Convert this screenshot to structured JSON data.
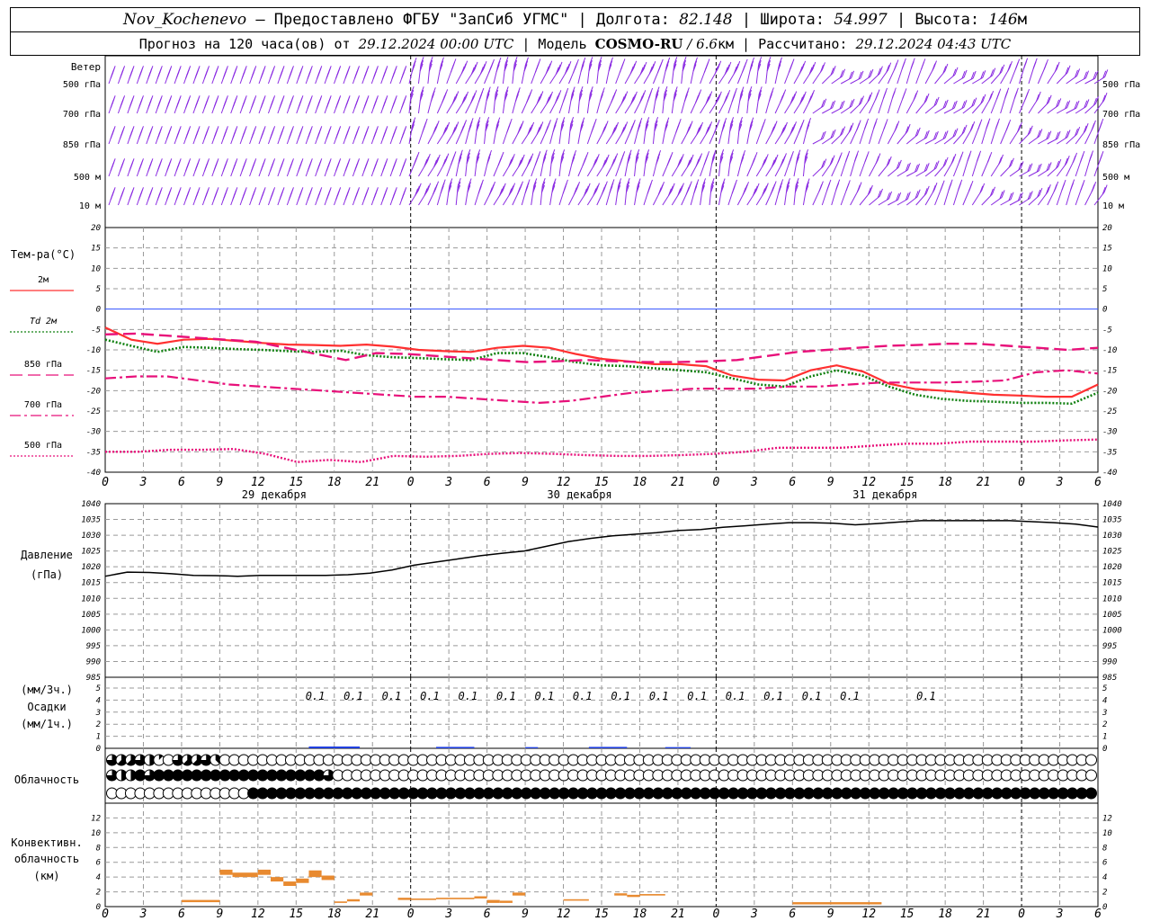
{
  "header": {
    "station": "Nov_Kochenevo",
    "provided_by": "— Предоставлено ФГБУ \"ЗапСиб УГМС\"",
    "sep1": " | Долгота: ",
    "lon": "82.148",
    "sep2": " | Широта: ",
    "lat": "54.997",
    "sep3": " | Высота: ",
    "alt": "146",
    "alt_unit": "м",
    "forecast_text": "Прогноз на 120 часа(ов) от ",
    "forecast_time": "29.12.2024 00:00 UTC",
    "model_text": " | Модель ",
    "model": "COSMO-RU",
    "model_sep": " / ",
    "resolution": "6.6",
    "resolution_unit": "км",
    "calc_text": " | Рассчитано: ",
    "calc_time": "29.12.2024 04:43 UTC"
  },
  "colors": {
    "t2m": "#ff3030",
    "td2m": "#108010",
    "t850": "#e8107a",
    "t700": "#e8107a",
    "t500": "#e8107a",
    "wind": "#8a2be2",
    "pressure": "#000000",
    "precip": "#2040e0",
    "convective": "#e88a30",
    "zero_line": "#3050ff"
  },
  "chart_data": [
    {
      "type": "barbs",
      "panel": "wind",
      "title": "Ветер",
      "levels": [
        "500 гПа",
        "700 гПа",
        "850 гПа",
        "500 м",
        "10  м"
      ],
      "x_hours": [
        0,
        3,
        6,
        9,
        12,
        15,
        18,
        21,
        24,
        27,
        30,
        33,
        36,
        39,
        42,
        45,
        48,
        51,
        54,
        57,
        60,
        63,
        66,
        69,
        72,
        75,
        78
      ],
      "barb_count_per_level": 106
    },
    {
      "type": "line",
      "panel": "temperature",
      "ylabel": "Тем-ра(°С)",
      "ylim": [
        -40,
        20
      ],
      "yticks": [
        20,
        15,
        10,
        5,
        0,
        -5,
        -10,
        -15,
        -20,
        -25,
        -30,
        -35,
        -40
      ],
      "x_hours": [
        0,
        1,
        2,
        3,
        4,
        5,
        6,
        7,
        8,
        9,
        10,
        11,
        12,
        13,
        14,
        15,
        16,
        17,
        18,
        19,
        20,
        21,
        22,
        23,
        24,
        25,
        26,
        27
      ],
      "series": [
        {
          "name": "2м",
          "values": [
            -4.5,
            -7.5,
            -8.5,
            -7.5,
            -7.3,
            -7.8,
            -8.3,
            -8.7,
            -8.8,
            -9.0,
            -8.7,
            -9.2,
            -10.0,
            -10.3,
            -10.5,
            -9.5,
            -9.0,
            -9.5,
            -11.0,
            -12.2,
            -12.8,
            -13.5,
            -13.5,
            -14.0,
            -16.3,
            -17.3,
            -17.5,
            -15.0,
            -13.8,
            -15.3,
            -18.3,
            -19.6,
            -20.0,
            -20.5,
            -21.0,
            -21.2,
            -21.5,
            -21.5,
            -18.5
          ]
        },
        {
          "name": "Td 2м",
          "values": [
            -7.5,
            -9.0,
            -10.5,
            -9.3,
            -9.5,
            -9.8,
            -10.0,
            -10.3,
            -10.5,
            -10.2,
            -11.3,
            -11.8,
            -12.0,
            -12.3,
            -12.5,
            -10.8,
            -10.8,
            -11.8,
            -13.0,
            -13.8,
            -14.0,
            -14.5,
            -15.0,
            -15.5,
            -17.0,
            -18.5,
            -19.0,
            -16.5,
            -15.0,
            -16.3,
            -19.0,
            -21.0,
            -22.0,
            -22.5,
            -22.7,
            -23.0,
            -23.0,
            -23.2,
            -20.5
          ]
        },
        {
          "name": "850 гПа",
          "values": [
            -6.2,
            -6.0,
            -6.5,
            -7.0,
            -7.5,
            -8.0,
            -9.5,
            -11.0,
            -12.5,
            -10.8,
            -11.0,
            -11.5,
            -12.0,
            -12.5,
            -13.0,
            -12.8,
            -12.5,
            -12.8,
            -13.0,
            -13.0,
            -12.8,
            -12.5,
            -11.5,
            -10.5,
            -10.0,
            -9.5,
            -9.0,
            -8.8,
            -8.5,
            -8.5,
            -9.0,
            -9.5,
            -10.0,
            -9.5
          ]
        },
        {
          "name": "700 гПа",
          "values": [
            -17.0,
            -16.5,
            -16.5,
            -17.5,
            -18.5,
            -19.0,
            -19.5,
            -20.0,
            -20.5,
            -21.0,
            -21.5,
            -21.5,
            -22.0,
            -22.5,
            -23.0,
            -22.5,
            -21.5,
            -20.5,
            -20.0,
            -19.5,
            -19.5,
            -19.5,
            -19.0,
            -19.0,
            -18.5,
            -18.0,
            -18.0,
            -18.0,
            -17.8,
            -17.5,
            -15.5,
            -15.0,
            -15.8
          ]
        },
        {
          "name": "500 гПа",
          "values": [
            -35.0,
            -35.0,
            -34.5,
            -34.5,
            -34.3,
            -35.5,
            -37.5,
            -37.0,
            -37.5,
            -36.0,
            -36.2,
            -36.0,
            -35.5,
            -35.3,
            -35.5,
            -35.8,
            -36.0,
            -36.0,
            -35.8,
            -35.5,
            -35.0,
            -34.0,
            -34.0,
            -34.0,
            -33.5,
            -33.0,
            -33.0,
            -32.5,
            -32.5,
            -32.5,
            -32.2,
            -32.0
          ]
        }
      ],
      "x_tick_labels": [
        "0",
        "3",
        "6",
        "9",
        "12",
        "15",
        "18",
        "21",
        "0",
        "3",
        "6",
        "9",
        "12",
        "15",
        "18",
        "21",
        "0",
        "3",
        "6",
        "9",
        "12",
        "15",
        "18",
        "21",
        "0",
        "3",
        "6"
      ],
      "day_labels": [
        "29 декабря",
        "30 декабря",
        "31 декабря"
      ]
    },
    {
      "type": "line",
      "panel": "pressure",
      "ylabel": "Давление",
      "yunit": "(гПа)",
      "ylim": [
        985,
        1040
      ],
      "yticks": [
        1040,
        1035,
        1030,
        1025,
        1020,
        1015,
        1010,
        1005,
        1000,
        995,
        990,
        985
      ],
      "series": [
        {
          "name": "pressure",
          "values": [
            1017.0,
            1018.3,
            1018.2,
            1017.8,
            1017.3,
            1017.2,
            1017.0,
            1017.3,
            1017.3,
            1017.3,
            1017.3,
            1017.5,
            1018.0,
            1019.0,
            1020.5,
            1021.5,
            1022.5,
            1023.5,
            1024.3,
            1025.0,
            1026.5,
            1028.0,
            1029.0,
            1029.8,
            1030.3,
            1030.8,
            1031.5,
            1031.8,
            1032.5,
            1033.0,
            1033.5,
            1034.0,
            1034.0,
            1033.8,
            1033.3,
            1033.7,
            1034.2,
            1034.6,
            1034.6,
            1034.6,
            1034.6,
            1034.6,
            1034.3,
            1034.0,
            1033.5,
            1032.6
          ]
        }
      ]
    },
    {
      "type": "bar",
      "panel": "precipitation",
      "ylabel1": "(мм/3ч.)",
      "ylabel2": "Осадки",
      "ylabel3": "(мм/1ч.)",
      "ylim": [
        0,
        5
      ],
      "yticks": [
        5,
        4,
        3,
        2,
        1,
        0
      ],
      "labels_3h": [
        {
          "hour": 18,
          "text": "0.1"
        },
        {
          "hour": 21,
          "text": "0.1"
        },
        {
          "hour": 24,
          "text": "0.1"
        },
        {
          "hour": 27,
          "text": "0.1"
        },
        {
          "hour": 30,
          "text": "0.1"
        },
        {
          "hour": 33,
          "text": "0.1"
        },
        {
          "hour": 36,
          "text": "0.1"
        },
        {
          "hour": 39,
          "text": "0.1"
        },
        {
          "hour": 42,
          "text": "0.1"
        },
        {
          "hour": 45,
          "text": "0.1"
        },
        {
          "hour": 48,
          "text": "0.1"
        },
        {
          "hour": 51,
          "text": "0.1"
        },
        {
          "hour": 54,
          "text": "0.1"
        },
        {
          "hour": 57,
          "text": "0.1"
        },
        {
          "hour": 60,
          "text": "0.1"
        },
        {
          "hour": 66,
          "text": "0.1"
        }
      ],
      "hourly": [
        {
          "from": 16,
          "to": 20,
          "value": 0.15
        },
        {
          "from": 26,
          "to": 29,
          "value": 0.12
        },
        {
          "from": 33,
          "to": 34,
          "value": 0.1
        },
        {
          "from": 38,
          "to": 41,
          "value": 0.12
        },
        {
          "from": 44,
          "to": 46,
          "value": 0.1
        }
      ]
    },
    {
      "type": "symbols",
      "panel": "cloudiness",
      "ylabel": "Облачность",
      "rows": [
        {
          "name": "high",
          "octas": [
            6,
            5,
            5,
            6,
            4,
            1,
            0,
            6,
            5,
            5,
            6,
            3,
            0,
            0,
            0,
            0,
            0,
            0,
            0,
            0,
            0,
            0,
            0,
            0,
            0,
            0,
            0,
            0,
            0,
            0,
            0,
            0,
            0,
            0,
            0,
            0,
            0,
            0,
            0,
            0,
            0,
            0,
            0,
            0,
            0,
            0,
            0,
            0,
            0,
            0,
            0,
            0,
            0,
            0,
            0,
            0,
            0,
            0,
            0,
            0,
            0,
            0,
            0,
            0,
            0,
            0,
            0,
            0,
            0,
            0,
            0,
            0,
            0,
            0,
            0,
            0,
            0,
            0,
            0,
            0,
            0,
            0,
            0,
            0,
            0,
            0,
            0,
            0,
            0,
            0,
            0,
            0,
            0,
            0,
            0,
            0,
            0,
            0,
            0,
            0,
            0,
            0,
            0,
            0,
            0
          ]
        },
        {
          "name": "middle",
          "octas": [
            6,
            4,
            4,
            8,
            6,
            8,
            8,
            8,
            8,
            8,
            8,
            8,
            8,
            8,
            8,
            8,
            8,
            8,
            8,
            8,
            8,
            8,
            8,
            6,
            0,
            0,
            0,
            0,
            0,
            0,
            0,
            0,
            0,
            0,
            0,
            0,
            0,
            0,
            0,
            0,
            0,
            0,
            0,
            0,
            0,
            0,
            0,
            0,
            0,
            0,
            0,
            0,
            0,
            0,
            0,
            0,
            0,
            0,
            0,
            0,
            0,
            0,
            0,
            0,
            0,
            0,
            0,
            0,
            0,
            0,
            0,
            0,
            0,
            0,
            0,
            0,
            0,
            0,
            0,
            0,
            0,
            0,
            0,
            0,
            0,
            0,
            0,
            0,
            0,
            0,
            0,
            0,
            0,
            0,
            0,
            0,
            0,
            0,
            0,
            0,
            0,
            0,
            0,
            0,
            0
          ]
        },
        {
          "name": "low",
          "octas": [
            0,
            0,
            0,
            0,
            0,
            0,
            0,
            0,
            0,
            0,
            0,
            0,
            0,
            0,
            0,
            8,
            8,
            8,
            8,
            8,
            8,
            8,
            8,
            8,
            8,
            8,
            8,
            8,
            8,
            8,
            8,
            8,
            8,
            8,
            8,
            8,
            8,
            8,
            8,
            8,
            8,
            8,
            8,
            8,
            8,
            8,
            8,
            8,
            8,
            8,
            8,
            8,
            8,
            8,
            8,
            8,
            8,
            8,
            8,
            8,
            8,
            8,
            8,
            8,
            8,
            8,
            8,
            8,
            8,
            8,
            8,
            8,
            8,
            8,
            8,
            8,
            8,
            8,
            8,
            8,
            8,
            8,
            8,
            8,
            8,
            8,
            8,
            8,
            8,
            8,
            8,
            8,
            8,
            8,
            8,
            8,
            8,
            8,
            8,
            8,
            8,
            8,
            8,
            8,
            8
          ]
        }
      ]
    },
    {
      "type": "bar",
      "panel": "convective",
      "ylabel1": "Конвективн.",
      "ylabel2": "облачность",
      "ylabel3": "(км)",
      "ylim": [
        0,
        14
      ],
      "yticks": [
        12,
        10,
        8,
        6,
        4,
        2,
        0
      ],
      "boxes": [
        {
          "from": 6,
          "to": 9,
          "base": 0.6,
          "top": 0.9
        },
        {
          "from": 9,
          "to": 10,
          "base": 4.3,
          "top": 5.0
        },
        {
          "from": 10,
          "to": 12,
          "base": 4.0,
          "top": 4.6
        },
        {
          "from": 12,
          "to": 13,
          "base": 4.3,
          "top": 5.0
        },
        {
          "from": 13,
          "to": 14,
          "base": 3.4,
          "top": 4.0
        },
        {
          "from": 14,
          "to": 15,
          "base": 2.8,
          "top": 3.4
        },
        {
          "from": 15,
          "to": 16,
          "base": 3.2,
          "top": 3.8
        },
        {
          "from": 16,
          "to": 17,
          "base": 4.0,
          "top": 4.9
        },
        {
          "from": 17,
          "to": 18,
          "base": 3.6,
          "top": 4.2
        },
        {
          "from": 18,
          "to": 19,
          "base": 0.5,
          "top": 0.7
        },
        {
          "from": 19,
          "to": 20,
          "base": 0.7,
          "top": 1.0
        },
        {
          "from": 20,
          "to": 21,
          "base": 1.5,
          "top": 1.9
        },
        {
          "from": 23,
          "to": 24,
          "base": 0.9,
          "top": 1.2
        },
        {
          "from": 24,
          "to": 26,
          "base": 0.9,
          "top": 1.1
        },
        {
          "from": 26,
          "to": 29,
          "base": 1.0,
          "top": 1.2
        },
        {
          "from": 29,
          "to": 30,
          "base": 1.1,
          "top": 1.4
        },
        {
          "from": 30,
          "to": 31,
          "base": 0.5,
          "top": 0.9
        },
        {
          "from": 31,
          "to": 32,
          "base": 0.5,
          "top": 0.8
        },
        {
          "from": 32,
          "to": 33,
          "base": 1.5,
          "top": 1.9
        },
        {
          "from": 36,
          "to": 38,
          "base": 0.8,
          "top": 1.0
        },
        {
          "from": 40,
          "to": 41,
          "base": 1.5,
          "top": 1.8
        },
        {
          "from": 41,
          "to": 42,
          "base": 1.3,
          "top": 1.6
        },
        {
          "from": 42,
          "to": 44,
          "base": 1.5,
          "top": 1.7
        },
        {
          "from": 54,
          "to": 61,
          "base": 0.3,
          "top": 0.6
        }
      ]
    }
  ]
}
